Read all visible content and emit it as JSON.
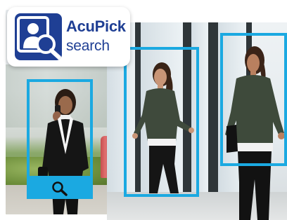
{
  "logo": {
    "name": "AcuPick",
    "subtitle": "search",
    "icon": "person-search-icon",
    "brand_color": "#1f3f94"
  },
  "detection": {
    "box_color": "#1ba9e1",
    "box_count": 3,
    "search_icon": "magnifier-icon"
  }
}
